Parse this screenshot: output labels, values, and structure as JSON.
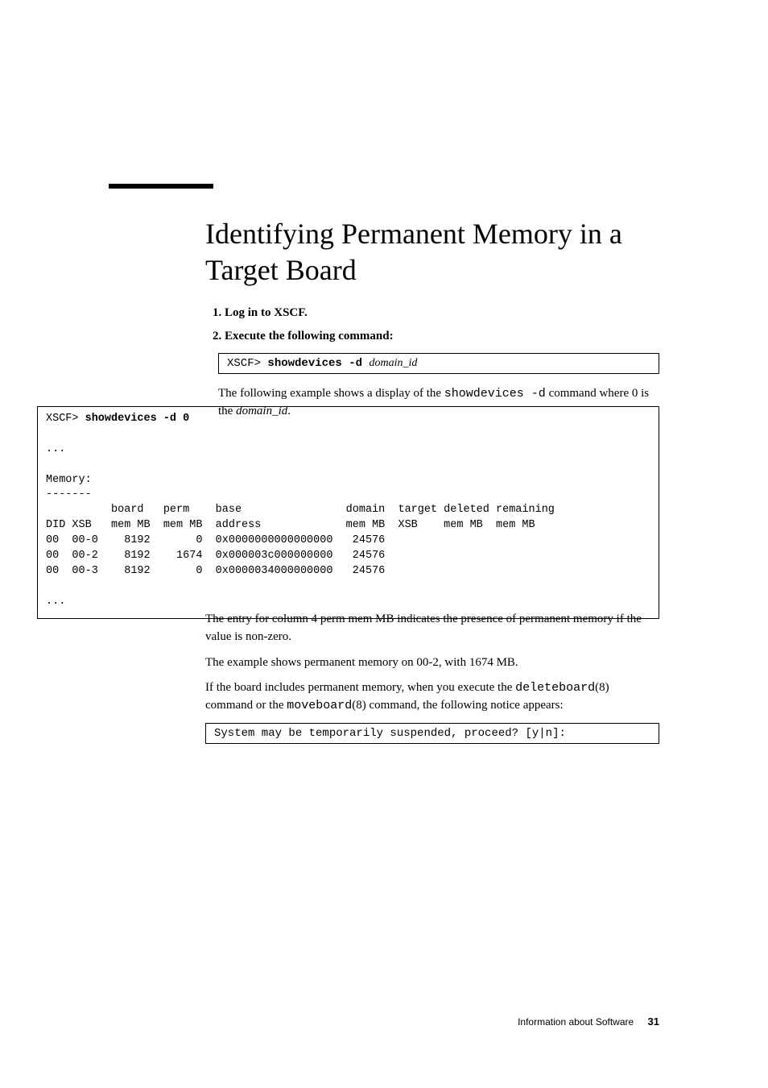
{
  "title": "Identifying Permanent Memory in a Target Board",
  "steps": [
    "Log in to XSCF.",
    "Execute the following command:"
  ],
  "cmd1": {
    "prompt": "XSCF> ",
    "command": "showdevices -d ",
    "arg": "domain_id"
  },
  "para1_a": "The following example shows a display of the ",
  "para1_mono": "showdevices -d",
  "para1_b": " command where 0 is the ",
  "para1_ital": "domain_id",
  "para1_c": ".",
  "wide": {
    "prompt": "XSCF> ",
    "command": "showdevices -d 0",
    "ellipsis1": "...",
    "section": "Memory:",
    "dash": "-------",
    "hdr1": "          board   perm    base                domain  target deleted remaining",
    "hdr2": "DID XSB   mem MB  mem MB  address             mem MB  XSB    mem MB  mem MB",
    "rows": [
      "00  00-0    8192       0  0x0000000000000000   24576",
      "00  00-2    8192    1674  0x000003c000000000   24576",
      "00  00-3    8192       0  0x0000034000000000   24576"
    ],
    "ellipsis2": "..."
  },
  "para2": "The entry for column 4 perm mem MB indicates the presence of permanent memory if the value is non-zero.",
  "para3": "The example shows permanent memory on 00-2, with 1674 MB.",
  "para4_a": "If the board includes permanent memory, when you execute the ",
  "para4_mono1": "deleteboard",
  "para4_b": "(8) command or the ",
  "para4_mono2": "moveboard",
  "para4_c": "(8) command, the following notice appears:",
  "cmd2": "System may be temporarily suspended, proceed? [y|n]:",
  "footer_text": "Information about Software",
  "page_number": "31"
}
